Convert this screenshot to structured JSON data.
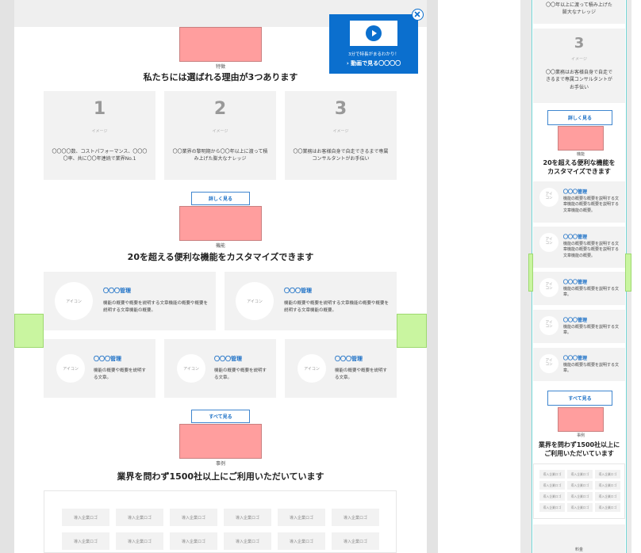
{
  "video_popup": {
    "caption": "3分で特長がまるわかり！",
    "link": "› 動画で見る〇〇〇〇"
  },
  "reasons": {
    "caption": "特徴",
    "title": "私たちには選ばれる理由が3つあります",
    "items": [
      {
        "num": "1",
        "img": "イメージ",
        "text": "〇〇〇〇数、コストパフォーマンス、〇〇〇〇率、共に〇〇年連続で業界No.1"
      },
      {
        "num": "2",
        "img": "イメージ",
        "text": "〇〇業界の黎明期から〇〇年以上に渡って積み上げた膨大なナレッジ"
      },
      {
        "num": "3",
        "img": "イメージ",
        "text": "〇〇業務はお客様自身で自走できるまで専属コンサルタントがお手伝い"
      }
    ],
    "more": "詳しく見る"
  },
  "features": {
    "caption": "機能",
    "title": "20を超える便利な機能をカスタマイズできます",
    "large": [
      {
        "icon": "アイコン",
        "title": "〇〇〇管理",
        "desc": "機能の概要や概要を説明する文章機能の概要や概要を説明する文章機能の概要。"
      },
      {
        "icon": "アイコン",
        "title": "〇〇〇管理",
        "desc": "機能の概要や概要を説明する文章機能の概要や概要を説明する文章機能の概要。"
      }
    ],
    "small": [
      {
        "icon": "アイコン",
        "title": "〇〇〇管理",
        "desc": "機能の概要や概要を説明する文章。"
      },
      {
        "icon": "アイコン",
        "title": "〇〇〇管理",
        "desc": "機能の概要や概要を説明する文章。"
      },
      {
        "icon": "アイコン",
        "title": "〇〇〇管理",
        "desc": "機能の概要や概要を説明する文章。"
      }
    ],
    "all": "すべて見る"
  },
  "cases": {
    "caption": "事例",
    "title": "業界を問わず1500社以上にご利用いただいています",
    "logo": "導入企業ロゴ"
  },
  "mobile": {
    "top_text": "〇〇年以上に渡って積み上げた膨大なナレッジ",
    "reason3_num": "3",
    "reason3_img": "イメージ",
    "reason3_text": "〇〇業務はお客様自身で自走できるまで専属コンサルタントがお手伝い",
    "more": "詳しく見る",
    "features_caption": "機能",
    "features_title_1": "20を超える便利な機能を",
    "features_title_2": "カスタマイズできます",
    "feature_items": [
      {
        "icon": "アイ\nコン",
        "title": "〇〇〇管理",
        "desc": "機能の概要な概要を説明する文章機能の概要な概要を説明する文章機能の概要。"
      },
      {
        "icon": "アイ\nコン",
        "title": "〇〇〇管理",
        "desc": "機能の概要な概要を説明する文章機能の概要な概要を説明する文章機能の概要。"
      },
      {
        "icon": "アイ\nコン",
        "title": "〇〇〇管理",
        "desc": "機能の概要な概要を説明する文章。"
      },
      {
        "icon": "アイ\nコン",
        "title": "〇〇〇管理",
        "desc": "機能の概要な概要を説明する文章。"
      },
      {
        "icon": "アイ\nコン",
        "title": "〇〇〇管理",
        "desc": "機能の概要な概要を説明する文章。"
      }
    ],
    "all": "すべて見る",
    "cases_caption": "事例",
    "cases_title_1": "業界を問わず1500社以上に",
    "cases_title_2": "ご利用いただいています",
    "logo": "導入企業ロゴ",
    "bottom_caption": "料金"
  }
}
